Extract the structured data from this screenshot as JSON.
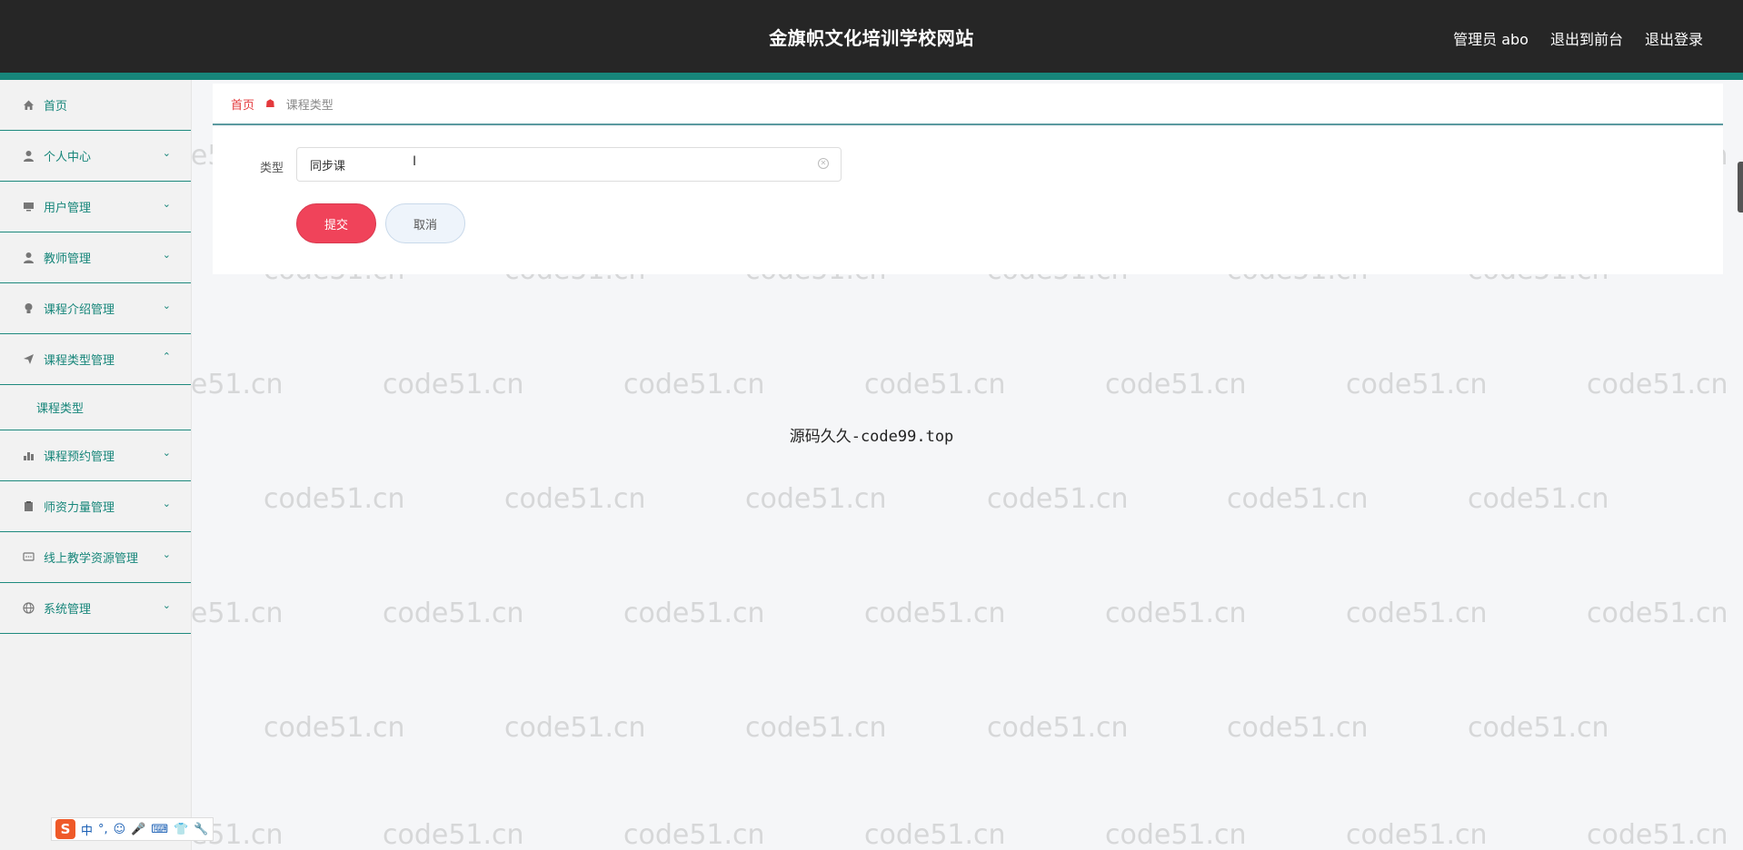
{
  "header": {
    "title": "金旗帜文化培训学校网站",
    "user": "管理员 abo",
    "back_to_front": "退出到前台",
    "logout": "退出登录"
  },
  "sidebar": {
    "items": [
      {
        "label": "首页",
        "icon": "home-icon",
        "expandable": false
      },
      {
        "label": "个人中心",
        "icon": "user-icon",
        "expandable": true
      },
      {
        "label": "用户管理",
        "icon": "monitor-icon",
        "expandable": true
      },
      {
        "label": "教师管理",
        "icon": "person-icon",
        "expandable": true
      },
      {
        "label": "课程介绍管理",
        "icon": "bulb-icon",
        "expandable": true
      },
      {
        "label": "课程类型管理",
        "icon": "send-icon",
        "expandable": true,
        "expanded": true
      },
      {
        "label": "课程预约管理",
        "icon": "bar-chart-icon",
        "expandable": true
      },
      {
        "label": "师资力量管理",
        "icon": "clipboard-icon",
        "expandable": true
      },
      {
        "label": "线上教学资源管理",
        "icon": "chat-icon",
        "expandable": true
      },
      {
        "label": "系统管理",
        "icon": "globe-icon",
        "expandable": true
      }
    ],
    "submenu": {
      "label": "课程类型"
    }
  },
  "breadcrumb": {
    "home": "首页",
    "current": "课程类型"
  },
  "form": {
    "type_label": "类型",
    "type_value": "同步课",
    "submit": "提交",
    "cancel": "取消"
  },
  "center_text": "源码久久-code99.top",
  "watermark_text": "code51.cn",
  "ime": {
    "label": "中"
  },
  "colors": {
    "accent": "#17867a",
    "header": "#262626",
    "submit": "#f0435a",
    "breadcrumb_home": "#e4393c"
  }
}
